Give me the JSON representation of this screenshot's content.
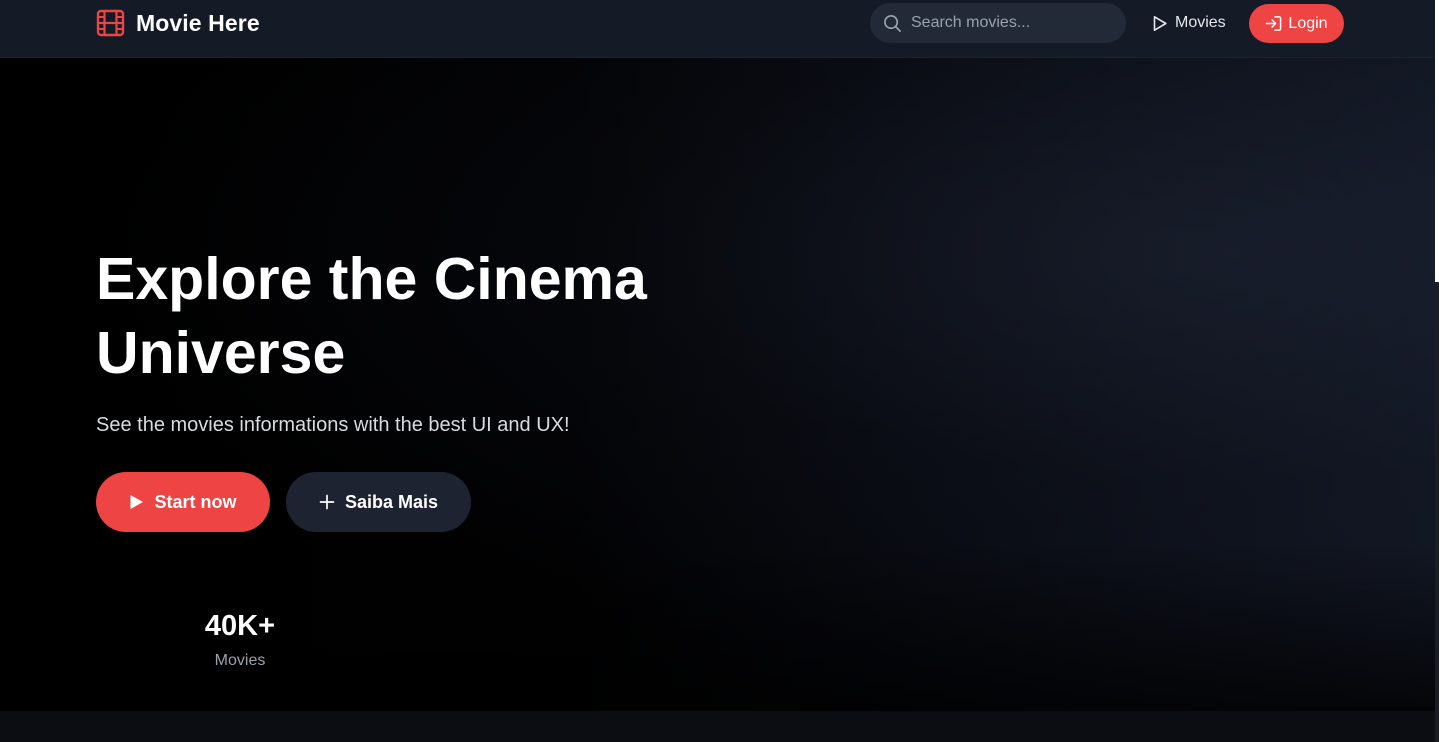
{
  "header": {
    "brand_name": "Movie Here",
    "brand_icon": "film-icon",
    "search": {
      "placeholder": "Search movies...",
      "value": "",
      "icon": "search-icon"
    },
    "nav_movies_label": "Movies",
    "nav_movies_icon": "play-outline-icon",
    "login_label": "Login",
    "login_icon": "login-arrow-icon"
  },
  "hero": {
    "title": "Explore the Cinema Universe",
    "subtitle": "See the movies informations with the best UI and UX!",
    "primary_button": {
      "label": "Start now",
      "icon": "play-icon"
    },
    "secondary_button": {
      "label": "Saiba Mais",
      "icon": "plus-icon"
    },
    "stats": [
      {
        "value": "40K+",
        "label": "Movies"
      }
    ]
  },
  "colors": {
    "accent": "#ef4444",
    "header_bg": "#141a26",
    "search_bg": "#222a38",
    "secondary_button_bg": "#1d2330",
    "text_muted": "#9aa1ad"
  }
}
